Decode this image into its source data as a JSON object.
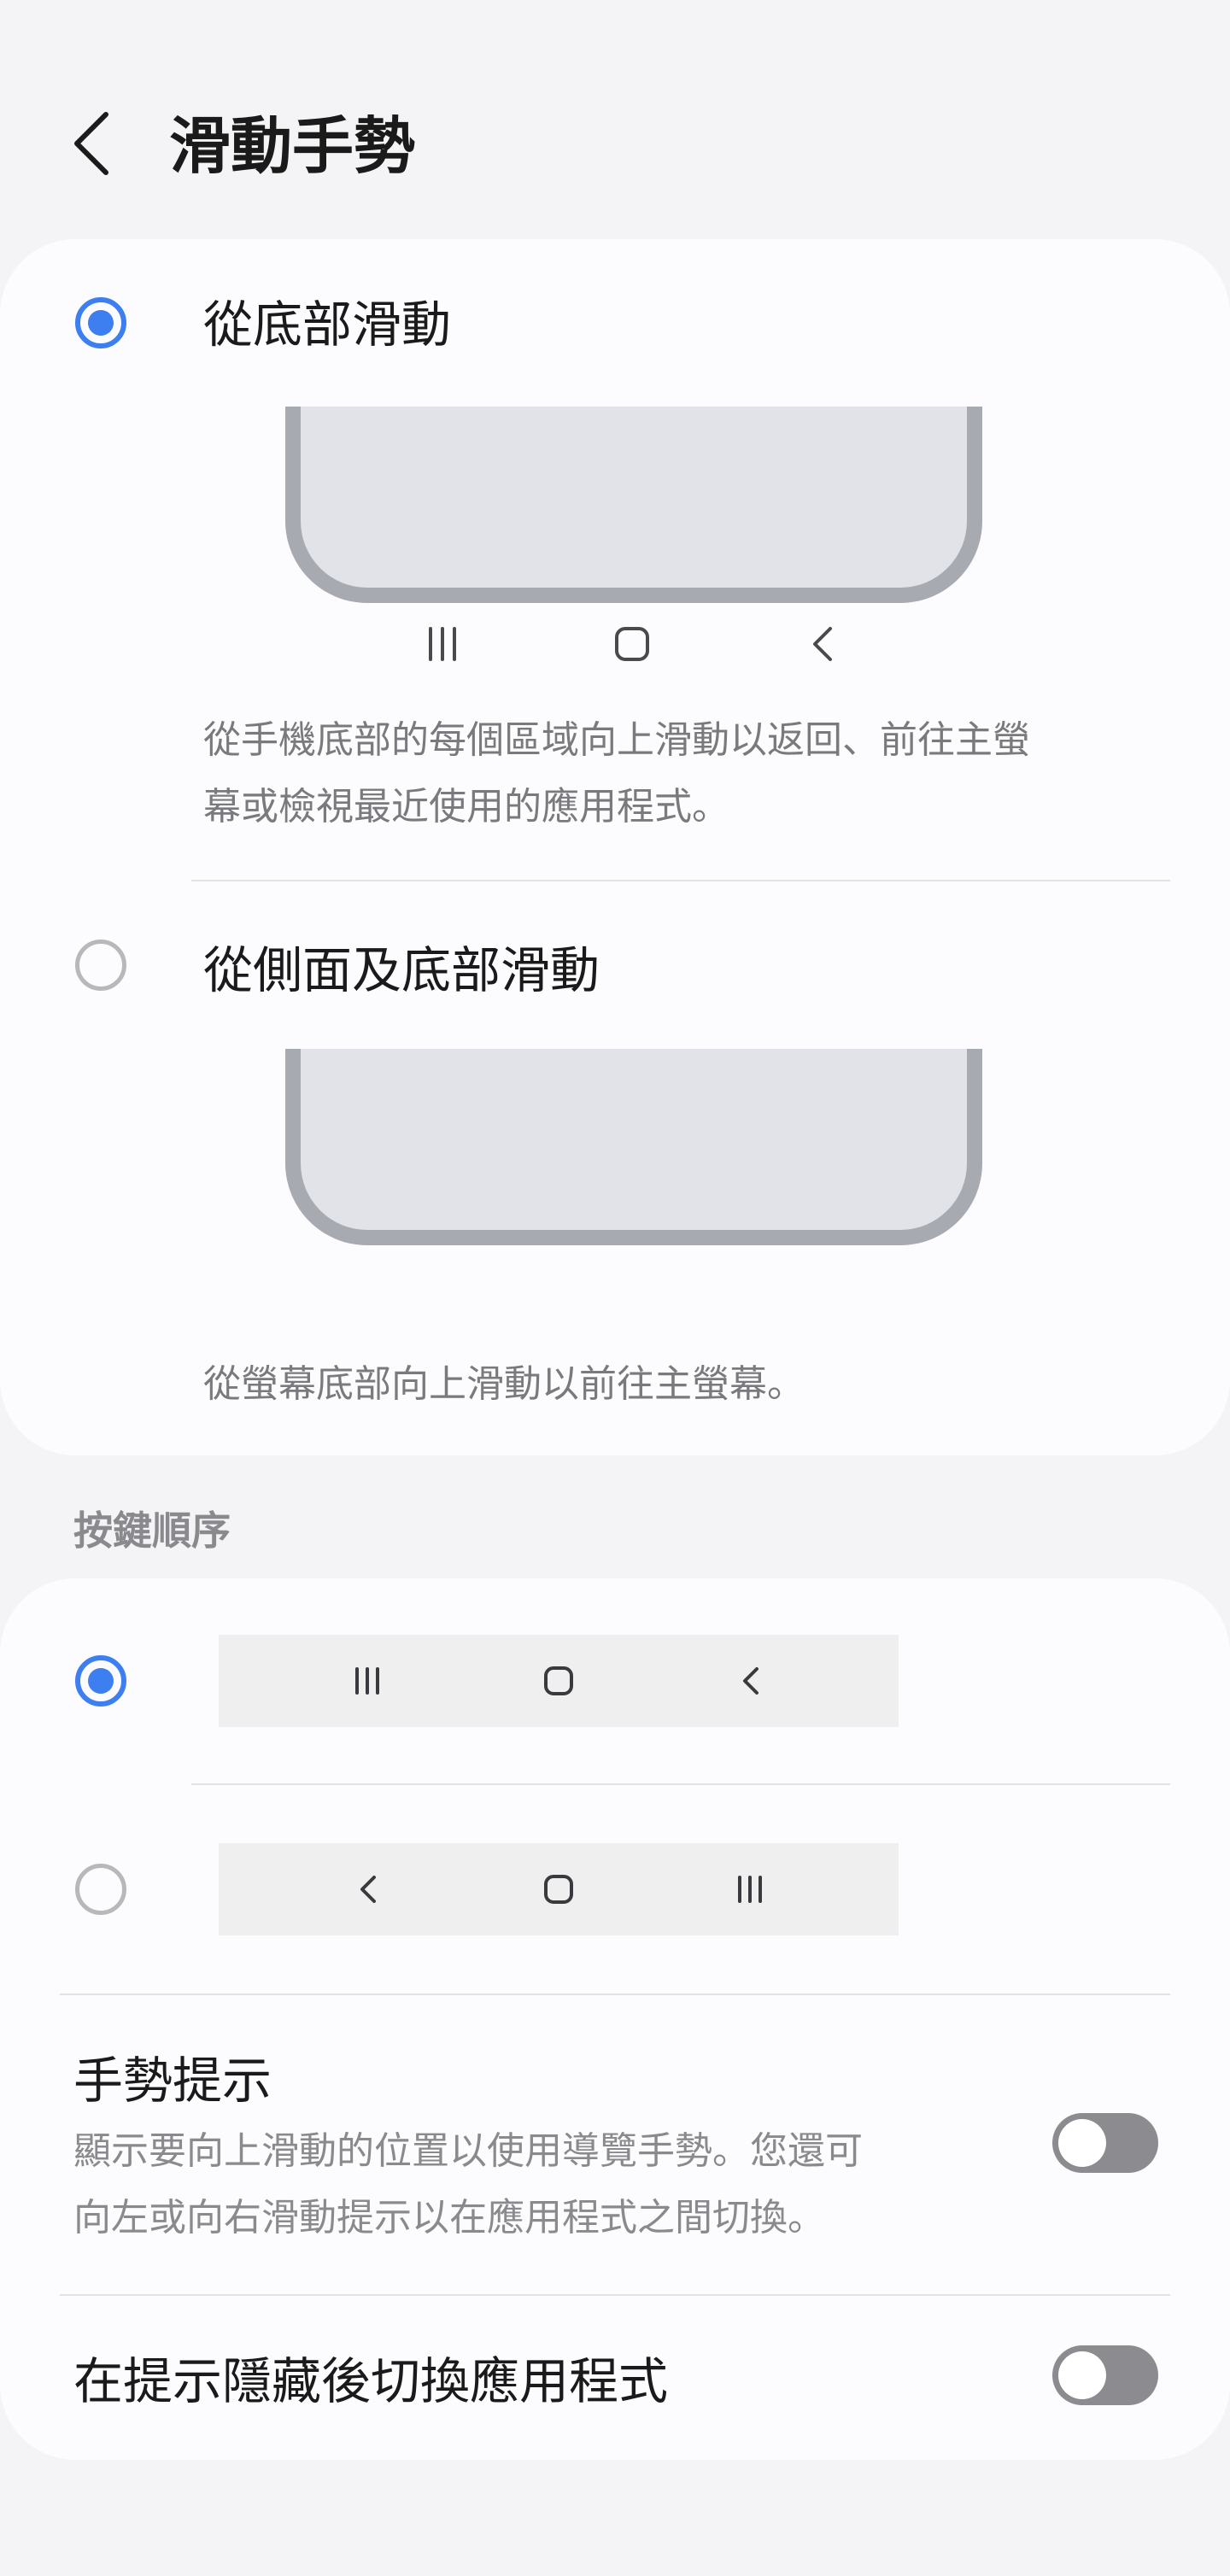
{
  "header": {
    "title": "滑動手勢",
    "back_icon": "back-icon"
  },
  "gesture_options": {
    "option1": {
      "label": "從底部滑動",
      "selected": true,
      "nav_icons": [
        "recents-icon",
        "home-icon",
        "back-icon"
      ],
      "description_lines": [
        "從手機底部的每個區域向上滑動以返回、前往主螢",
        "幕或檢視最近使用的應用程式。"
      ]
    },
    "option2": {
      "label": "從側面及底部滑動",
      "selected": false,
      "description": "從螢幕底部向上滑動以前往主螢幕。"
    }
  },
  "button_order": {
    "section_title": "按鍵順序",
    "option1": {
      "selected": true,
      "icons": [
        "recents-icon",
        "home-icon",
        "back-icon"
      ]
    },
    "option2": {
      "selected": false,
      "icons": [
        "back-icon",
        "home-icon",
        "recents-icon"
      ]
    }
  },
  "gesture_hint": {
    "title": "手勢提示",
    "description_lines": [
      "顯示要向上滑動的位置以使用導覽手勢。您還可",
      "向左或向右滑動提示以在應用程式之間切換。"
    ],
    "enabled": false
  },
  "switch_apps": {
    "title": "在提示隱藏後切換應用程式",
    "enabled": false
  },
  "colors": {
    "accent": "#3d7ff1",
    "background": "#f4f4f6",
    "card": "#fcfcfe",
    "toggle_off": "#8c8c90"
  }
}
